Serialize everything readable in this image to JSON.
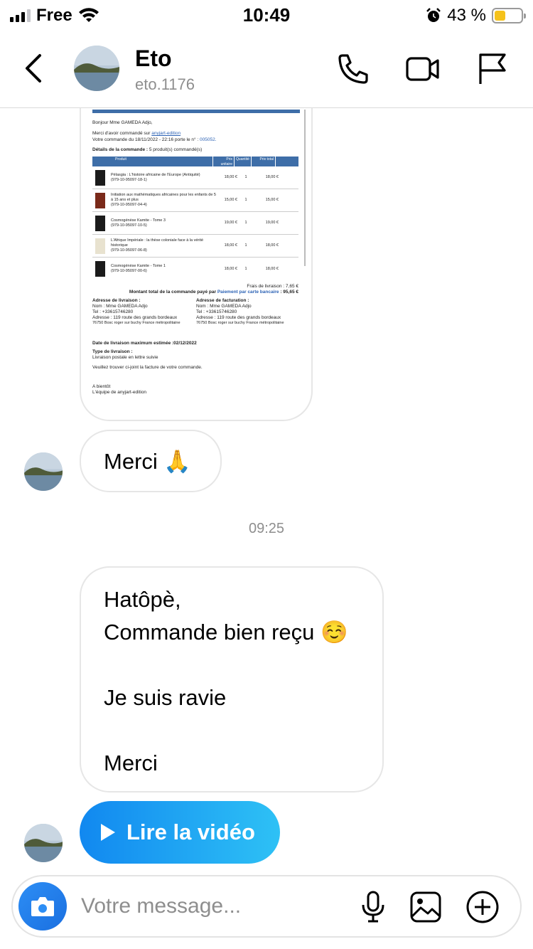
{
  "status_bar": {
    "carrier": "Free",
    "time": "10:49",
    "battery_percent": "43 %",
    "battery_level": 0.43,
    "signal_bars": 3
  },
  "header": {
    "name": "Eto",
    "username": "eto.1176",
    "icons": [
      "back-chevron-icon",
      "phone-icon",
      "video-camera-icon",
      "flag-icon"
    ]
  },
  "invoice": {
    "greeting": "Bonjour Mme GAMEDA Adjo,",
    "thanks_prefix": "Merci d'avoir commandé sur ",
    "shop": "anyjart-edition",
    "order_line_prefix": "Votre commande du 18/11/2022 - 22:16 porte le n° : ",
    "order_number": "005052.",
    "details_title": "Détails de la commande :",
    "details_count": "5 produit(s) commandé(s)",
    "headers": [
      "Produit",
      "Prix unitaire",
      "Quantité",
      "Prix total"
    ],
    "rows": [
      {
        "title": "Pélasgia : L'histoire africaine de l'Europe (Antiquité)",
        "isbn": "(979-10-95097-18-1)",
        "unit": "18,00 €",
        "qty": "1",
        "total": "18,00 €"
      },
      {
        "title": "Initiation aux mathématiques africaines pour les enfants de 5 à 15 ans et plus",
        "isbn": "(979-10-95097-04-4)",
        "unit": "15,00 €",
        "qty": "1",
        "total": "15,00 €"
      },
      {
        "title": "Cosmogénèse Kamite - Tome 3",
        "isbn": "(979-10-95097-10-5)",
        "unit": "19,00 €",
        "qty": "1",
        "total": "19,00 €"
      },
      {
        "title": "L'Afrique Impériale : la thèse coloniale face à la vérité historique",
        "isbn": "(979-10-95097-06-8)",
        "unit": "18,00 €",
        "qty": "1",
        "total": "18,00 €"
      },
      {
        "title": "Cosmogénèse Kamite - Tome 1",
        "isbn": "(979-10-95097-00-6)",
        "unit": "18,00 €",
        "qty": "1",
        "total": "18,00 €"
      }
    ],
    "shipping": "Frais de livraison : 7,65 €",
    "total_prefix": "Montant total de la commande payé par ",
    "payment": "Paiement par carte bancaire",
    "total_suffix": " : 95,65 €",
    "delivery_title": "Adresse de livraison :",
    "billing_title": "Adresse de facturation :",
    "addr_name": "Nom : Mme GAMEDA Adjo",
    "addr_tel": "Tel : +33615746280",
    "addr_line1": "Adresse : 119 route des grands bordeaux",
    "addr_line2": "76750 Bosc roger sur buchy France métropolitaine",
    "max_date": "Date de livraison maximum estimée :02/12/2022",
    "delivery_type_title": "Type de livraison :",
    "delivery_type": "Livraison postale en lettre suivie",
    "attachment_note": "Veuillez trouver ci-joint la facture de votre commande.",
    "bye": "A bientôt",
    "signature": "L'équipe de anyjart-edition"
  },
  "messages": {
    "merci_1": "Merci 🙏",
    "timestamp": "09:25",
    "reply_lines": [
      "Hatôpè,",
      "Commande bien reçu ☺️",
      "",
      "Je suis ravie",
      "",
      "Merci"
    ]
  },
  "video": {
    "label": "Lire la vidéo"
  },
  "composer": {
    "placeholder": "Votre message...",
    "icons": [
      "camera-icon",
      "microphone-icon",
      "gallery-icon",
      "plus-circle-icon"
    ]
  },
  "colors": {
    "video_gradient_start": "#1188f0",
    "video_gradient_end": "#2ec1f5",
    "camera_button": "#2d8ef5",
    "invoice_header": "#3e6ea8"
  }
}
